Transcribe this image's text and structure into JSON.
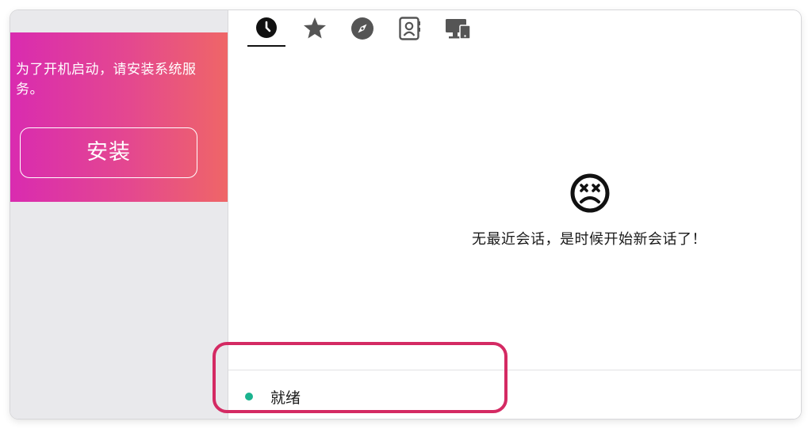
{
  "sidebar": {
    "promo": {
      "message": "为了开机启动，请安装系统服务。",
      "install_label": "安装"
    }
  },
  "tabs": [
    {
      "icon": "clock-icon",
      "name": "recent",
      "active": true
    },
    {
      "icon": "star-icon",
      "name": "favorites",
      "active": false
    },
    {
      "icon": "compass-icon",
      "name": "discover",
      "active": false
    },
    {
      "icon": "address-book-icon",
      "name": "contacts",
      "active": false
    },
    {
      "icon": "devices-icon",
      "name": "devices",
      "active": false
    }
  ],
  "main": {
    "empty_state": {
      "icon": "dizzy-face-icon",
      "message": "无最近会话，是时候开始新会话了！"
    }
  },
  "status": {
    "label": "就绪",
    "color": "#1bb38f"
  },
  "colors": {
    "promo_gradient_start": "#d92bb0",
    "promo_gradient_end": "#ef6667",
    "highlight": "#d42a63",
    "sidebar_bg": "#e9e9ec"
  }
}
